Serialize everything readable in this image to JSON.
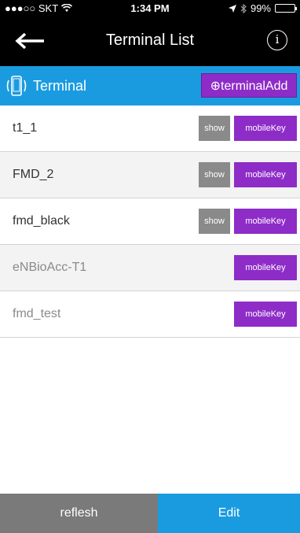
{
  "status_bar": {
    "carrier": "●●●○○ SKT",
    "time": "1:34 PM",
    "battery": "99%",
    "battery_level": 0.99
  },
  "nav": {
    "title": "Terminal List",
    "info_glyph": "i"
  },
  "section": {
    "label": "Terminal",
    "add_button": "⊕terminalAdd"
  },
  "terminals": [
    {
      "name": "t1_1",
      "show": "show",
      "key": "mobileKey",
      "enabled": true
    },
    {
      "name": "FMD_2",
      "show": "show",
      "key": "mobileKey",
      "enabled": true
    },
    {
      "name": "fmd_black",
      "show": "show",
      "key": "mobileKey",
      "enabled": true
    },
    {
      "name": "eNBioAcc-T1",
      "show": null,
      "key": "mobileKey",
      "enabled": false
    },
    {
      "name": "fmd_test",
      "show": null,
      "key": "mobileKey",
      "enabled": false
    }
  ],
  "tabs": {
    "left": "reflesh",
    "right": "Edit"
  },
  "colors": {
    "accent_blue": "#1a9be0",
    "button_purple": "#8e2cc8",
    "button_gray": "#8a8a8a"
  }
}
